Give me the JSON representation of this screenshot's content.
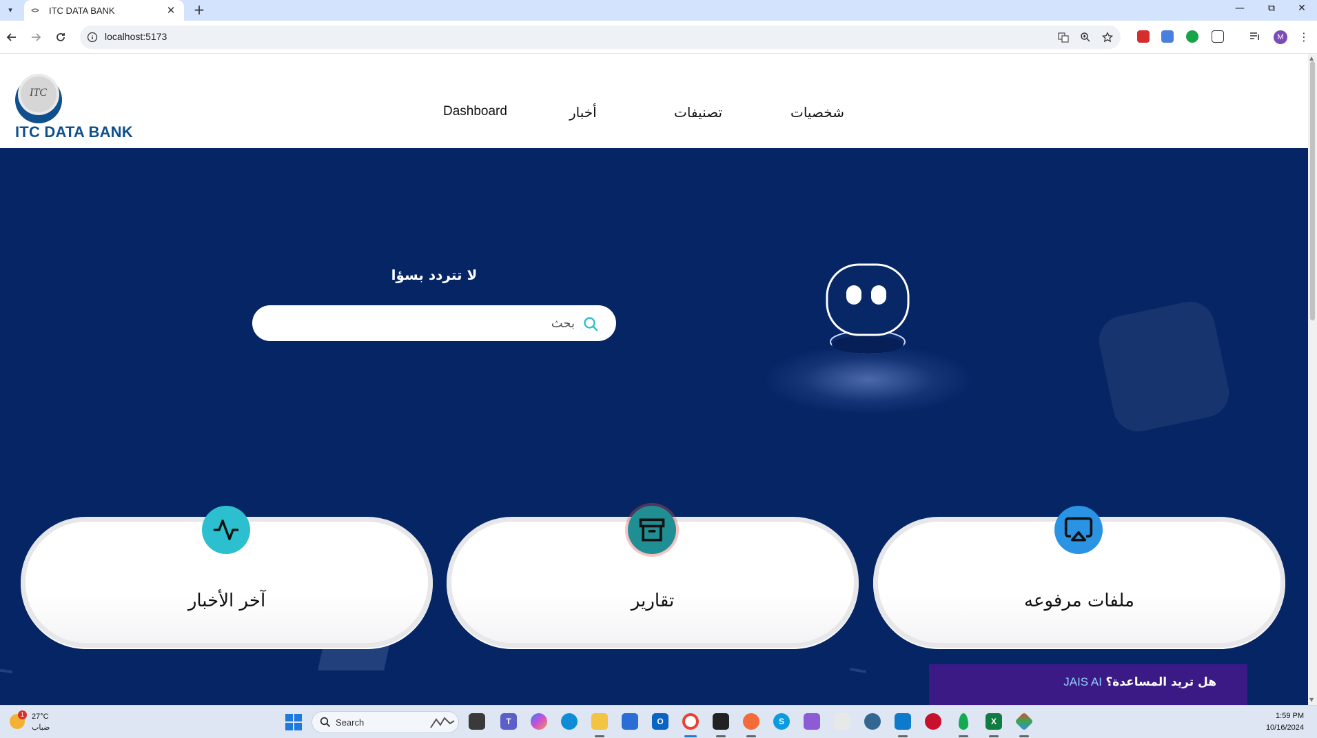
{
  "browser": {
    "tab_title": "ITC DATA BANK",
    "url": "localhost:5173",
    "profile_initial": "M"
  },
  "header": {
    "logo_badge": "ITC",
    "logo_text": "ITC DATA BANK",
    "nav": [
      {
        "label": "Dashboard"
      },
      {
        "label": "أخبار"
      },
      {
        "label": "تصنيفات"
      },
      {
        "label": "شخصيات"
      }
    ]
  },
  "hero": {
    "question": "لا تتردد بسؤا",
    "search_placeholder": "بحث"
  },
  "cards": [
    {
      "label": "آخر الأخبار",
      "icon": "activity-icon",
      "color": "#2bbfcf"
    },
    {
      "label": "تقارير",
      "icon": "archive-icon",
      "color": "#1f8f93"
    },
    {
      "label": "ملفات مرفوعه",
      "icon": "airplay-icon",
      "color": "#2a93e4"
    }
  ],
  "help": {
    "question": "هل تريد المساعدة؟",
    "brand": "JAIS AI"
  },
  "taskbar": {
    "weather_temp": "27°C",
    "weather_condition": "ضباب",
    "weather_badge": "1",
    "search_label": "Search",
    "time": "1:59 PM",
    "date": "10/16/2024"
  },
  "colors": {
    "hero_background": "#062565",
    "logo_blue": "#0f4f8d",
    "help_background": "#3b1a86"
  }
}
